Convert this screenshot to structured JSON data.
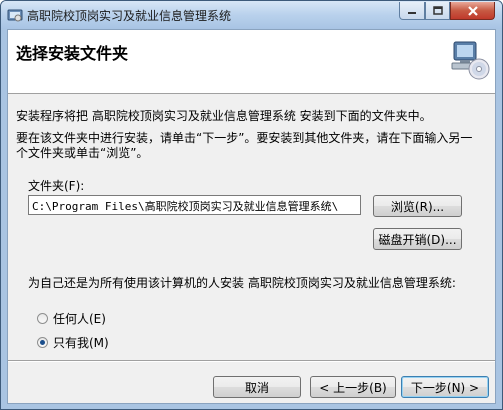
{
  "window": {
    "title": "高职院校顶岗实习及就业信息管理系统",
    "min_glyph": "▬",
    "max_glyph": "▢",
    "close_glyph": "✕"
  },
  "header": {
    "title": "选择安装文件夹"
  },
  "body": {
    "intro": "安装程序将把 高职院校顶岗实习及就业信息管理系统 安装到下面的文件夹中。",
    "instruction_line1": "要在该文件夹中进行安装，请单击“下一步”。要安装到其他文件夹，请在下面输入另一",
    "instruction_line2": "个文件夹或单击“浏览”。",
    "folder_label": "文件夹(F):",
    "folder_value": "C:\\Program Files\\高职院校顶岗实习及就业信息管理系统\\",
    "browse_label": "浏览(R)...",
    "disk_cost_label": "磁盘开销(D)...",
    "scope_question": "为自己还是为所有使用该计算机的人安装 高职院校顶岗实习及就业信息管理系统:",
    "radio_everyone": "任何人(E)",
    "radio_just_me": "只有我(M)",
    "selected": "just_me"
  },
  "footer": {
    "cancel_label": "取消",
    "back_label": "< 上一步(B)",
    "next_label": "下一步(N) >"
  },
  "icons": {
    "app": "installer-app-icon",
    "header": "computer-cd-icon"
  }
}
